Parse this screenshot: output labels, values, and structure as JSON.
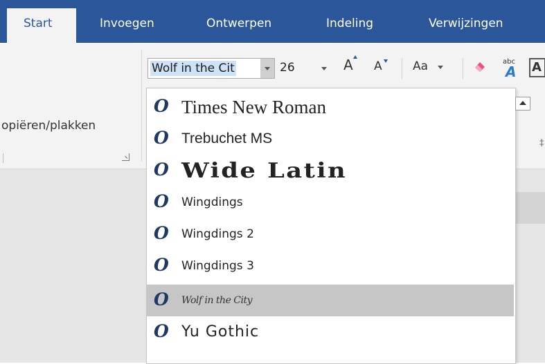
{
  "tabs": [
    {
      "label": "Start",
      "active": true
    },
    {
      "label": "Invoegen",
      "active": false
    },
    {
      "label": "Ontwerpen",
      "active": false
    },
    {
      "label": "Indeling",
      "active": false
    },
    {
      "label": "Verwijzingen",
      "active": false
    }
  ],
  "clipboard": {
    "label": "opiëren/plakken"
  },
  "font_box": {
    "value": "Wolf in the Cit"
  },
  "size_box": {
    "value": "26"
  },
  "case_button": {
    "label": "Aa"
  },
  "abc_button": {
    "small": "abc",
    "big": "A"
  },
  "font_color_button": {
    "label": "A"
  },
  "font_list": {
    "items": [
      {
        "name": "Times New Roman",
        "selected": false
      },
      {
        "name": "Trebuchet MS",
        "selected": false
      },
      {
        "name": "Wide Latin",
        "selected": false
      },
      {
        "name": "Wingdings",
        "selected": false
      },
      {
        "name": "Wingdings 2",
        "selected": false
      },
      {
        "name": "Wingdings 3",
        "selected": false
      },
      {
        "name": "Wolf in the City",
        "selected": true
      },
      {
        "name": "Yu Gothic",
        "selected": false
      }
    ],
    "type_icon": "O"
  },
  "colors": {
    "ribbon_blue": "#2b579a",
    "highlight": "#cfe3f7",
    "selected_row": "#c6c6c6"
  }
}
